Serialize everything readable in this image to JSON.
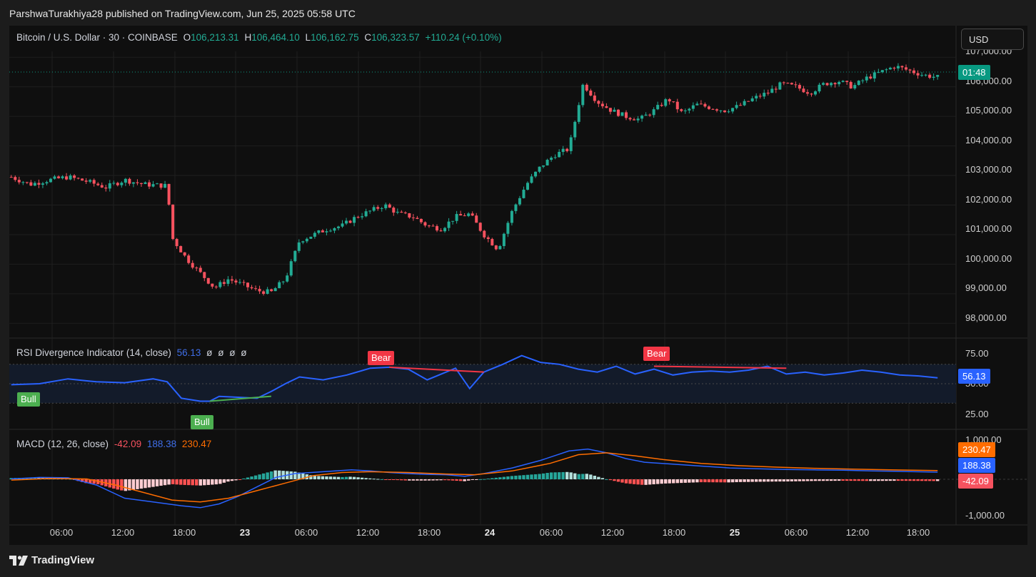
{
  "header": {
    "publisher_line": "ParshwaTurakhiya28 published on TradingView.com, Jun 25, 2025 05:58 UTC"
  },
  "symbol_legend": {
    "title": "Bitcoin / U.S. Dollar · 30 · COINBASE",
    "o_label": "O",
    "o_value": "106,213.31",
    "h_label": "H",
    "h_value": "106,464.10",
    "l_label": "L",
    "l_value": "106,162.75",
    "c_label": "C",
    "c_value": "106,323.57",
    "change": "+110.24 (+0.10%)"
  },
  "currency_button": "USD",
  "price_axis": {
    "labels": [
      "107,000.00",
      "106,000.00",
      "105,000.00",
      "104,000.00",
      "103,000.00",
      "102,000.00",
      "101,000.00",
      "100,000.00",
      "99,000.00",
      "98,000.00"
    ],
    "countdown_badge": "01:48"
  },
  "rsi": {
    "title": "RSI Divergence Indicator (14, close)",
    "value": "56.13",
    "extras": [
      "ø",
      "ø",
      "ø",
      "ø"
    ],
    "axis_labels": [
      "75.00",
      "50.00",
      "25.00"
    ],
    "badge": "56.13",
    "signals": [
      {
        "label": "Bull",
        "type": "bull"
      },
      {
        "label": "Bull",
        "type": "bull"
      },
      {
        "label": "Bear",
        "type": "bear"
      },
      {
        "label": "Bear",
        "type": "bear"
      }
    ],
    "levels": {
      "upper": 70,
      "middle": 50,
      "lower": 30
    }
  },
  "macd": {
    "title": "MACD (12, 26, close)",
    "hist_value": "-42.09",
    "macd_value": "188.38",
    "signal_value": "230.47",
    "axis_labels": [
      "1,000.00",
      "-1,000.00"
    ],
    "badges": {
      "signal": "230.47",
      "macd": "188.38",
      "hist": "-42.09"
    }
  },
  "time_axis": {
    "labels": [
      "06:00",
      "12:00",
      "18:00",
      "23",
      "06:00",
      "12:00",
      "18:00",
      "24",
      "06:00",
      "12:00",
      "18:00",
      "25",
      "06:00",
      "12:00",
      "18:00"
    ],
    "bold": [
      false,
      false,
      false,
      true,
      false,
      false,
      false,
      true,
      false,
      false,
      false,
      true,
      false,
      false,
      false
    ]
  },
  "footer": {
    "brand": "TradingView"
  },
  "colors": {
    "up": "#22ab94",
    "down": "#f7525f",
    "rsi_line": "#2962ff",
    "macd_line": "#2962ff",
    "signal_line": "#ff6d00",
    "bull": "#4caf50",
    "bear": "#f23645"
  },
  "chart_data": {
    "type": "candlestick",
    "symbol": "Bitcoin / U.S. Dollar",
    "interval": "30",
    "exchange": "COINBASE",
    "ylim": [
      97500,
      107200
    ],
    "x_ticks": [
      "06:00",
      "12:00",
      "18:00",
      "23",
      "06:00",
      "12:00",
      "18:00",
      "24",
      "06:00",
      "12:00",
      "18:00",
      "25",
      "06:00",
      "12:00",
      "18:00"
    ],
    "price_path": [
      [
        0,
        102950
      ],
      [
        4,
        102700
      ],
      [
        8,
        102850
      ],
      [
        12,
        102950
      ],
      [
        16,
        102800
      ],
      [
        20,
        102600
      ],
      [
        24,
        102850
      ],
      [
        28,
        102700
      ],
      [
        33,
        102650
      ],
      [
        34,
        100900
      ],
      [
        37,
        100200
      ],
      [
        40,
        99700
      ],
      [
        43,
        99200
      ],
      [
        46,
        99500
      ],
      [
        49,
        99300
      ],
      [
        52,
        99100
      ],
      [
        55,
        99050
      ],
      [
        58,
        99500
      ],
      [
        61,
        100800
      ],
      [
        64,
        101000
      ],
      [
        67,
        101200
      ],
      [
        70,
        101300
      ],
      [
        73,
        101600
      ],
      [
        76,
        101800
      ],
      [
        79,
        102000
      ],
      [
        82,
        101700
      ],
      [
        85,
        101600
      ],
      [
        88,
        101300
      ],
      [
        91,
        101200
      ],
      [
        94,
        101600
      ],
      [
        97,
        101700
      ],
      [
        100,
        101000
      ],
      [
        103,
        100500
      ],
      [
        106,
        101800
      ],
      [
        109,
        102700
      ],
      [
        112,
        103300
      ],
      [
        115,
        103700
      ],
      [
        118,
        103900
      ],
      [
        121,
        106100
      ],
      [
        124,
        105500
      ],
      [
        127,
        105200
      ],
      [
        130,
        105000
      ],
      [
        133,
        104900
      ],
      [
        136,
        105200
      ],
      [
        139,
        105600
      ],
      [
        142,
        105100
      ],
      [
        145,
        105400
      ],
      [
        148,
        105300
      ],
      [
        151,
        105200
      ],
      [
        154,
        105350
      ],
      [
        157,
        105600
      ],
      [
        160,
        105800
      ],
      [
        163,
        106100
      ],
      [
        166,
        106000
      ],
      [
        169,
        105800
      ],
      [
        172,
        106100
      ],
      [
        175,
        106200
      ],
      [
        178,
        106000
      ],
      [
        181,
        106300
      ],
      [
        184,
        106500
      ],
      [
        187,
        106700
      ],
      [
        190,
        106550
      ],
      [
        193,
        106400
      ],
      [
        196,
        106324
      ]
    ],
    "rsi_series": [
      [
        0,
        49
      ],
      [
        6,
        50
      ],
      [
        12,
        55
      ],
      [
        18,
        52
      ],
      [
        24,
        51
      ],
      [
        30,
        55
      ],
      [
        33,
        52
      ],
      [
        36,
        35
      ],
      [
        40,
        32
      ],
      [
        42,
        32
      ],
      [
        44,
        37
      ],
      [
        48,
        36
      ],
      [
        52,
        35
      ],
      [
        55,
        42
      ],
      [
        58,
        50
      ],
      [
        61,
        57
      ],
      [
        66,
        54
      ],
      [
        71,
        59
      ],
      [
        76,
        66
      ],
      [
        80,
        67
      ],
      [
        84,
        65
      ],
      [
        88,
        54
      ],
      [
        91,
        60
      ],
      [
        94,
        66
      ],
      [
        97,
        45
      ],
      [
        100,
        62
      ],
      [
        104,
        70
      ],
      [
        108,
        79
      ],
      [
        112,
        72
      ],
      [
        116,
        70
      ],
      [
        120,
        65
      ],
      [
        124,
        62
      ],
      [
        128,
        68
      ],
      [
        132,
        60
      ],
      [
        136,
        65
      ],
      [
        140,
        59
      ],
      [
        144,
        62
      ],
      [
        148,
        63
      ],
      [
        152,
        62
      ],
      [
        156,
        64
      ],
      [
        160,
        68
      ],
      [
        164,
        60
      ],
      [
        168,
        62
      ],
      [
        172,
        59
      ],
      [
        176,
        61
      ],
      [
        180,
        64
      ],
      [
        184,
        62
      ],
      [
        188,
        59
      ],
      [
        192,
        58
      ],
      [
        196,
        56.13
      ]
    ],
    "macd_series": [
      [
        0,
        10
      ],
      [
        6,
        50
      ],
      [
        12,
        40
      ],
      [
        18,
        -150
      ],
      [
        24,
        -500
      ],
      [
        30,
        -600
      ],
      [
        36,
        -700
      ],
      [
        40,
        -750
      ],
      [
        44,
        -650
      ],
      [
        48,
        -450
      ],
      [
        52,
        -200
      ],
      [
        56,
        50
      ],
      [
        60,
        150
      ],
      [
        66,
        200
      ],
      [
        72,
        250
      ],
      [
        76,
        220
      ],
      [
        80,
        180
      ],
      [
        84,
        150
      ],
      [
        88,
        130
      ],
      [
        92,
        120
      ],
      [
        96,
        80
      ],
      [
        100,
        150
      ],
      [
        106,
        300
      ],
      [
        112,
        500
      ],
      [
        118,
        750
      ],
      [
        122,
        800
      ],
      [
        126,
        700
      ],
      [
        130,
        550
      ],
      [
        134,
        450
      ],
      [
        140,
        400
      ],
      [
        146,
        350
      ],
      [
        152,
        300
      ],
      [
        158,
        280
      ],
      [
        164,
        260
      ],
      [
        170,
        250
      ],
      [
        176,
        240
      ],
      [
        182,
        220
      ],
      [
        188,
        210
      ],
      [
        196,
        188.38
      ]
    ],
    "signal_series": [
      [
        0,
        -20
      ],
      [
        8,
        20
      ],
      [
        16,
        10
      ],
      [
        22,
        -150
      ],
      [
        28,
        -350
      ],
      [
        34,
        -550
      ],
      [
        40,
        -600
      ],
      [
        46,
        -500
      ],
      [
        52,
        -300
      ],
      [
        58,
        -100
      ],
      [
        64,
        100
      ],
      [
        70,
        180
      ],
      [
        76,
        200
      ],
      [
        84,
        180
      ],
      [
        92,
        140
      ],
      [
        98,
        120
      ],
      [
        106,
        220
      ],
      [
        114,
        420
      ],
      [
        120,
        650
      ],
      [
        126,
        700
      ],
      [
        132,
        620
      ],
      [
        138,
        520
      ],
      [
        146,
        420
      ],
      [
        154,
        360
      ],
      [
        162,
        320
      ],
      [
        170,
        290
      ],
      [
        178,
        270
      ],
      [
        186,
        250
      ],
      [
        196,
        230.47
      ]
    ]
  }
}
